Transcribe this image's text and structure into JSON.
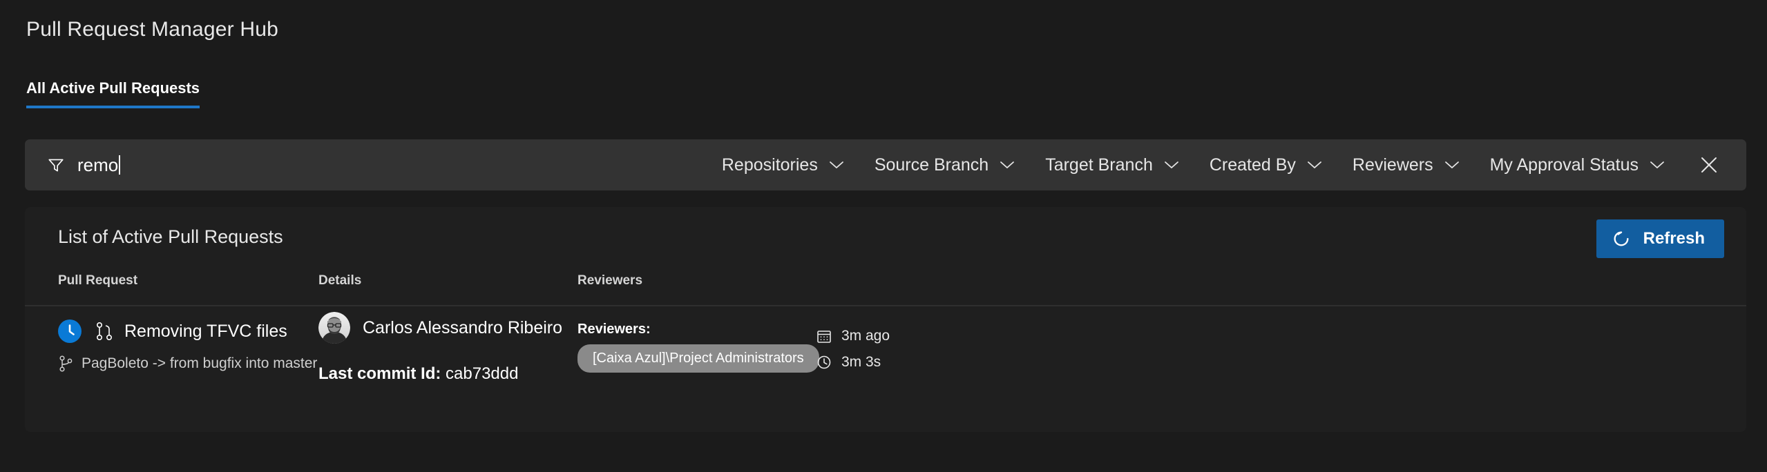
{
  "header": {
    "hub_title": "Pull Request Manager Hub"
  },
  "tabs": [
    {
      "label": "All Active Pull Requests",
      "selected": true
    }
  ],
  "filter_bar": {
    "funnel_icon": "filter-funnel-icon",
    "search_value": "remo",
    "search_placeholder": "Filter by title",
    "menus": [
      {
        "label": "Repositories",
        "icon": "chevron-down-icon"
      },
      {
        "label": "Source Branch",
        "icon": "chevron-down-icon"
      },
      {
        "label": "Target Branch",
        "icon": "chevron-down-icon"
      },
      {
        "label": "Created By",
        "icon": "chevron-down-icon"
      },
      {
        "label": "Reviewers",
        "icon": "chevron-down-icon"
      },
      {
        "label": "My Approval Status",
        "icon": "chevron-down-icon"
      }
    ],
    "close_icon": "close-icon"
  },
  "list": {
    "title": "List of Active Pull Requests",
    "refresh_label": "Refresh",
    "refresh_icon": "refresh-icon",
    "columns": [
      "Pull Request",
      "Details",
      "Reviewers"
    ],
    "rows": [
      {
        "status_icon": "clock-status-icon",
        "pr_icon": "pull-request-icon",
        "title": "Removing TFVC files",
        "branch_icon": "branch-icon",
        "branches": "PagBoleto -> from bugfix into master",
        "author_avatar": "user-avatar",
        "author": "Carlos Alessandro Ribeiro",
        "commit_label": "Last commit Id:",
        "commit_id": "cab73ddd",
        "reviewers_label": "Reviewers:",
        "reviewers": [
          "[Caixa Azul]\\Project Administrators"
        ],
        "created_icon": "calendar-icon",
        "created": "3m ago",
        "duration_icon": "clock-icon",
        "duration": "3m 3s"
      }
    ]
  },
  "colors": {
    "page_background": "#1b1b1b",
    "filter_bar_background": "#333333",
    "card_background": "#1f1f1f",
    "accent_blue": "#1f77c7",
    "button_blue": "#125ea0",
    "status_blue": "#0a7ad6",
    "pill_gray": "#8a8a8a"
  }
}
